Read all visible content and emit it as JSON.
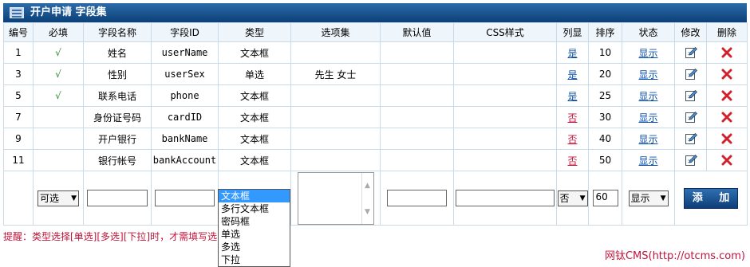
{
  "header": {
    "title": "开户申请 字段集"
  },
  "columns": [
    "编号",
    "必填",
    "字段名称",
    "字段ID",
    "类型",
    "选项集",
    "默认值",
    "CSS样式",
    "列显",
    "排序",
    "状态",
    "修改",
    "删除"
  ],
  "rows": [
    {
      "num": "1",
      "req": "√",
      "name": "姓名",
      "fid": "userName",
      "type": "文本框",
      "opts": "",
      "def": "",
      "css": "",
      "list": "是",
      "sort": "10",
      "state": "显示"
    },
    {
      "num": "3",
      "req": "√",
      "name": "性别",
      "fid": "userSex",
      "type": "单选",
      "opts": "先生 女士",
      "def": "",
      "css": "",
      "list": "是",
      "sort": "20",
      "state": "显示"
    },
    {
      "num": "5",
      "req": "√",
      "name": "联系电话",
      "fid": "phone",
      "type": "文本框",
      "opts": "",
      "def": "",
      "css": "",
      "list": "是",
      "sort": "25",
      "state": "显示"
    },
    {
      "num": "7",
      "req": "",
      "name": "身份证号码",
      "fid": "cardID",
      "type": "文本框",
      "opts": "",
      "def": "",
      "css": "",
      "list": "否",
      "sort": "30",
      "state": "显示"
    },
    {
      "num": "9",
      "req": "",
      "name": "开户银行",
      "fid": "bankName",
      "type": "文本框",
      "opts": "",
      "def": "",
      "css": "",
      "list": "否",
      "sort": "40",
      "state": "显示"
    },
    {
      "num": "11",
      "req": "",
      "name": "银行帐号",
      "fid": "bankAccount",
      "type": "文本框",
      "opts": "",
      "def": "",
      "css": "",
      "list": "否",
      "sort": "50",
      "state": "显示"
    }
  ],
  "add_form": {
    "required_select": "可选",
    "type_options": [
      "文本框",
      "多行文本框",
      "密码框",
      "单选",
      "多选",
      "下拉"
    ],
    "type_selected": "文本框",
    "list_select": "否",
    "sort_value": "60",
    "state_select": "显示",
    "add_button": "添 加"
  },
  "tip": "提醒：类型选择[单选][多选][下拉]时，才需填写选",
  "footer": "网钛CMS(http://otcms.com)",
  "colors": {
    "accent": "#0b3f78",
    "link": "#0b4fa8",
    "warn": "#c0143c"
  }
}
